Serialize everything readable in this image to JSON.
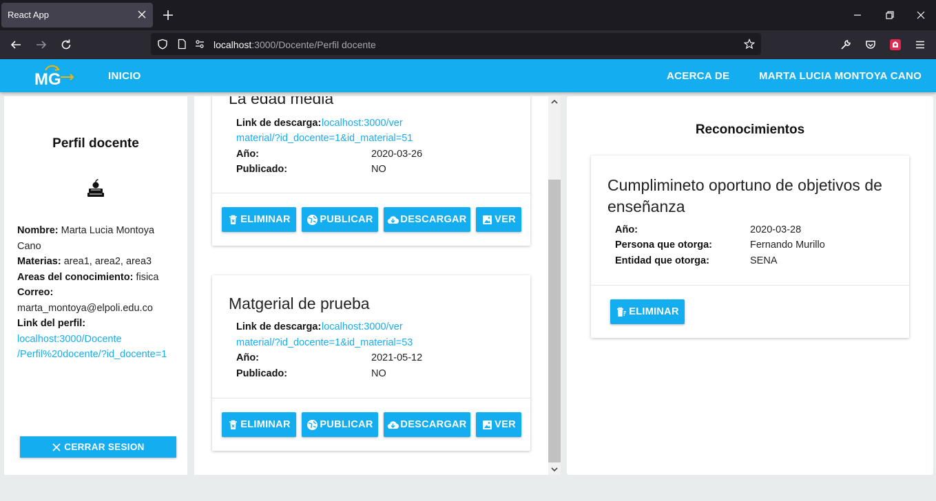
{
  "browser": {
    "tab_title": "React App",
    "url_host": "localhost",
    "url_rest": ":3000/Docente/Perfil docente"
  },
  "appbar": {
    "logo_text": "MG",
    "nav_home": "INICIO",
    "nav_about": "ACERCA DE",
    "nav_user": "MARTA LUCIA MONTOYA CANO"
  },
  "profile": {
    "title": "Perfil docente",
    "name_label": "Nombre:",
    "name_value": "Marta Lucia Montoya Cano",
    "subjects_label": "Materias:",
    "subjects_value": "area1, area2, area3",
    "areas_label": "Areas del conocimiento:",
    "areas_value": "fisica",
    "email_label": "Correo:",
    "email_value": "marta_montoya@elpoli.edu.co",
    "link_label": "Link del perfil:",
    "link_line1": "localhost:3000/Docente",
    "link_line2": "/Perfil%20docente/?id_docente=1",
    "logout_label": "CERRAR SESION"
  },
  "materials": {
    "items": [
      {
        "title": "La edad media",
        "link_label": "Link de descarga:",
        "link_line1": "localhost:3000/ver",
        "link_line2": "material/?id_docente=1&id_material=51",
        "year_label": "Año:",
        "year_value": "2020-03-26",
        "published_label": "Publicado:",
        "published_value": "NO"
      },
      {
        "title": "Matgerial de prueba",
        "link_label": "Link de descarga:",
        "link_line1": "localhost:3000/ver",
        "link_line2": "material/?id_docente=1&id_material=53",
        "year_label": "Año:",
        "year_value": "2021-05-12",
        "published_label": "Publicado:",
        "published_value": "NO"
      }
    ],
    "buttons": {
      "delete": "ELIMINAR",
      "publish": "PUBLICAR",
      "download": "DESCARGAR",
      "view": "VER"
    }
  },
  "recognitions": {
    "title": "Reconocimientos",
    "items": [
      {
        "title_line1": "Cumplimineto oportuno de objetivos de",
        "title_line2": "enseñanza",
        "year_label": "Año:",
        "year_value": "2020-03-28",
        "grantor_label": "Persona que otorga:",
        "grantor_value": "Fernando Murillo",
        "entity_label": "Entidad que otorga:",
        "entity_value": "SENA",
        "delete_label": "ELIMINAR"
      }
    ]
  },
  "colors": {
    "accent": "#14aef0",
    "browser_dark": "#1c1b22",
    "browser_bar": "#2b2a33",
    "background": "#e9ecec"
  }
}
